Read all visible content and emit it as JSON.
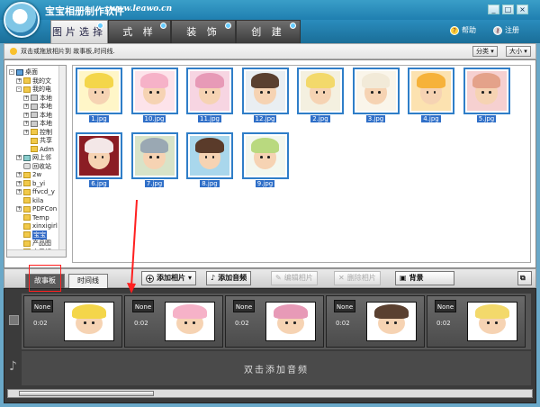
{
  "app": {
    "title": "宝宝相册制作软件",
    "url": "www.leawo.cn",
    "window_buttons": [
      "_",
      "□",
      "×"
    ]
  },
  "nav": {
    "tabs": [
      {
        "label": "图片选择",
        "active": true
      },
      {
        "label": "式 样",
        "active": false
      },
      {
        "label": "装 饰",
        "active": false
      },
      {
        "label": "创 建",
        "active": false
      }
    ],
    "help_label": "帮助",
    "register_label": "注册"
  },
  "hint": {
    "text": "双击或拖放相片到 故事板,时间线.",
    "sort_label": "分类",
    "size_label": "大小"
  },
  "tree": {
    "items": [
      {
        "label": "桌面",
        "icon": "desktop-icon",
        "level": 0,
        "expander": "-"
      },
      {
        "label": "我的文",
        "icon": "folder-icon",
        "level": 1,
        "expander": "+"
      },
      {
        "label": "我的电",
        "icon": "folder-icon",
        "level": 1,
        "expander": "-"
      },
      {
        "label": "本地",
        "icon": "drive-icon",
        "level": 2,
        "expander": "+"
      },
      {
        "label": "本地",
        "icon": "drive-icon",
        "level": 2,
        "expander": "+"
      },
      {
        "label": "本地",
        "icon": "drive-icon",
        "level": 2,
        "expander": "+"
      },
      {
        "label": "本地",
        "icon": "drive-icon",
        "level": 2,
        "expander": "+"
      },
      {
        "label": "控制",
        "icon": "folder-icon",
        "level": 2,
        "expander": "+"
      },
      {
        "label": "共享",
        "icon": "folder-icon",
        "level": 2,
        "expander": ""
      },
      {
        "label": "Adm",
        "icon": "folder-icon",
        "level": 2,
        "expander": ""
      },
      {
        "label": "网上邻",
        "icon": "network-icon",
        "level": 1,
        "expander": "+"
      },
      {
        "label": "回收站",
        "icon": "recycle-bin-icon",
        "level": 1,
        "expander": ""
      },
      {
        "label": "2w",
        "icon": "folder-icon",
        "level": 1,
        "expander": "+"
      },
      {
        "label": "b_yi",
        "icon": "folder-icon",
        "level": 1,
        "expander": "+"
      },
      {
        "label": "ffvcd_y",
        "icon": "folder-icon",
        "level": 1,
        "expander": "+"
      },
      {
        "label": "kila",
        "icon": "folder-icon",
        "level": 1,
        "expander": ""
      },
      {
        "label": "PDFCon",
        "icon": "folder-icon",
        "level": 1,
        "expander": "+"
      },
      {
        "label": "Temp",
        "icon": "folder-icon",
        "level": 1,
        "expander": ""
      },
      {
        "label": "xinxigirl",
        "icon": "folder-icon",
        "level": 1,
        "expander": ""
      },
      {
        "label": "宝宝",
        "icon": "folder-icon",
        "level": 1,
        "expander": "",
        "selected": true
      },
      {
        "label": "产品图",
        "icon": "folder-icon",
        "level": 1,
        "expander": ""
      },
      {
        "label": "电子相",
        "icon": "folder-icon",
        "level": 1,
        "expander": "+"
      }
    ]
  },
  "photos": [
    {
      "name": "1.jpg",
      "hat": "#f4d64a",
      "bg": "#fff6c8"
    },
    {
      "name": "10.jpg",
      "hat": "#f6b2c8",
      "bg": "#fde3ea"
    },
    {
      "name": "11.jpg",
      "hat": "#e79ab7",
      "bg": "#f7d5e2"
    },
    {
      "name": "12.jpg",
      "hat": "#5a4030",
      "bg": "#e9eef2"
    },
    {
      "name": "2.jpg",
      "hat": "#f3d96b",
      "bg": "#f4f0e0"
    },
    {
      "name": "3.jpg",
      "hat": "#f2ead8",
      "bg": "#faf5ea"
    },
    {
      "name": "4.jpg",
      "hat": "#f6b23a",
      "bg": "#fce2b0"
    },
    {
      "name": "5.jpg",
      "hat": "#e4a28a",
      "bg": "#f6d0d0"
    },
    {
      "name": "6.jpg",
      "hat": "#f3e7e7",
      "bg": "#8b1d24"
    },
    {
      "name": "7.jpg",
      "hat": "#9aa8b3",
      "bg": "#d8e3c8"
    },
    {
      "name": "8.jpg",
      "hat": "#5a3b2a",
      "bg": "#a9d7ec"
    },
    {
      "name": "9.jpg",
      "hat": "#b9d97f",
      "bg": "#f3f7ee"
    }
  ],
  "toolbar": {
    "add_photo": "添加相片",
    "add_audio": "添加音频",
    "edit_photo": "编辑相片",
    "delete_photo": "删除相片",
    "background": "背景"
  },
  "story_tabs": {
    "storyboard": "故事板",
    "timeline": "时间线"
  },
  "storyboard": {
    "slots": [
      {
        "transition": "None",
        "duration": "0:02",
        "photo": "1.jpg"
      },
      {
        "transition": "None",
        "duration": "0:02",
        "photo": "10.jpg"
      },
      {
        "transition": "None",
        "duration": "0:02",
        "photo": "11.jpg"
      },
      {
        "transition": "None",
        "duration": "0:02",
        "photo": "12.jpg"
      },
      {
        "transition": "None",
        "duration": "0:02",
        "photo": "2.jpg"
      }
    ],
    "audio_hint": "双击添加音频"
  },
  "colors": {
    "accent_blue": "#2f7ec8",
    "selection": "#3169c6",
    "annotation_red": "#ff2020"
  }
}
